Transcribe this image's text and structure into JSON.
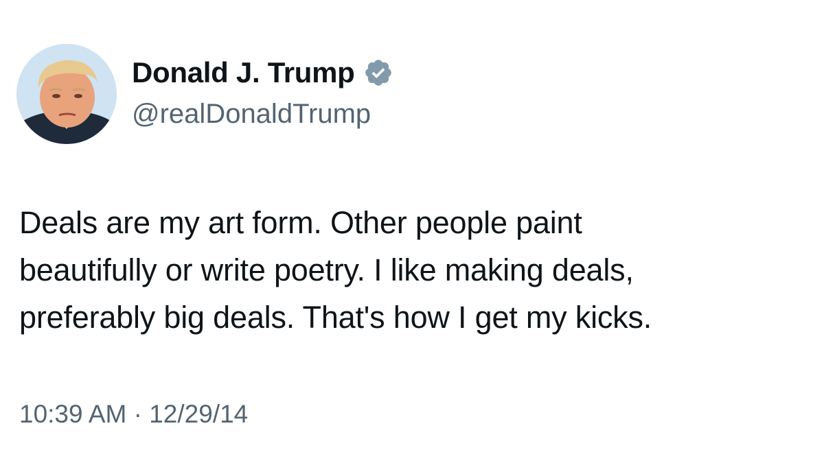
{
  "author": {
    "name": "Donald J. Trump",
    "handle": "@realDonaldTrump",
    "verified_color": "#829aab"
  },
  "tweet": {
    "lines": [
      "Deals are my art form. Other people paint",
      "beautifully or write poetry. I like making deals,",
      "preferably big deals. That's how I get my kicks."
    ],
    "time": "10:39 AM",
    "separator": "·",
    "date": "12/29/14"
  },
  "colors": {
    "text": "#0f1419",
    "secondary": "#536471",
    "background": "#ffffff"
  }
}
